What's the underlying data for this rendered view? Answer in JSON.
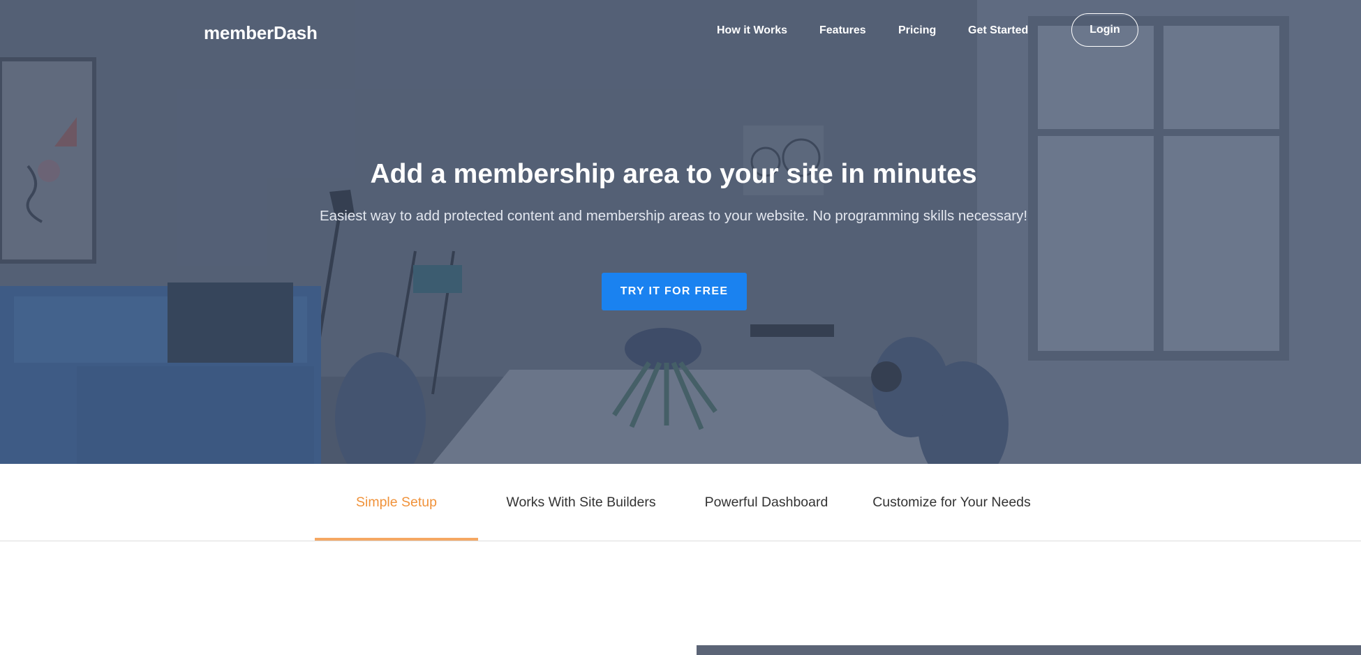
{
  "brand": {
    "name": "memberDash"
  },
  "nav": {
    "links": [
      "How it Works",
      "Features",
      "Pricing",
      "Get Started"
    ],
    "login_label": "Login"
  },
  "hero": {
    "headline": "Add a membership area to your site in minutes",
    "subheadline": "Easiest way to add protected content and membership areas to your website. No programming skills necessary!",
    "cta_label": "TRY IT FOR FREE"
  },
  "feature_tabs": {
    "items": [
      "Simple Setup",
      "Works With Site Builders",
      "Powerful Dashboard",
      "Customize for Your Needs"
    ],
    "active": "Simple Setup"
  },
  "colors": {
    "accent": "#1a82f0",
    "tab_active": "#f0923a",
    "tab_underline": "#f5a863",
    "hero_overlay": "#4e5a72"
  }
}
